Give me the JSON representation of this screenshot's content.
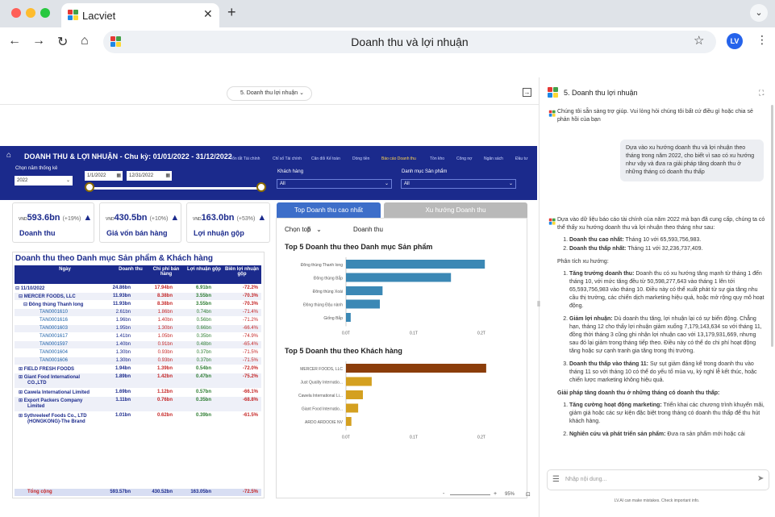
{
  "browser": {
    "tab_title": "Lacviet",
    "url_title": "Doanh thu và lợi nhuận",
    "avatar": "LV",
    "icons": [
      "back-icon",
      "forward-icon",
      "reload-icon",
      "home-icon",
      "star-icon",
      "menu-icon"
    ]
  },
  "report": {
    "page_selector": "5. Doanh thu lợi nhuận",
    "title": "DOANH THU & LỢI NHUẬN - Chu kỳ: 01/01/2022 - 31/12/2022",
    "nav_tabs": [
      "Tổn tắt Tài chính",
      "Chỉ số Tài chính",
      "Cân đối Kế toán",
      "Dòng tiền",
      "Báo cáo Doanh thu",
      "Tồn kho",
      "Công nợ",
      "Ngân sách",
      "Đầu tư"
    ],
    "filters": {
      "year_label": "Chọn năm thống kê",
      "year_value": "2022",
      "date_from": "1/1/2022",
      "date_to": "12/31/2022",
      "customer_label": "Khách hàng",
      "customer_value": "All",
      "category_label": "Danh mục Sản phẩm",
      "category_value": "All"
    },
    "kpis": [
      {
        "prefix": "VND",
        "value": "593.6bn",
        "change": "(+19%)",
        "label": "Doanh thu"
      },
      {
        "prefix": "VND",
        "value": "430.5bn",
        "change": "(+10%)",
        "label": "Giá vốn bán hàng"
      },
      {
        "prefix": "VND",
        "value": "163.0bn",
        "change": "(+53%)",
        "label": "Lợi nhuận gộp"
      }
    ],
    "table": {
      "title": "Doanh thu theo Danh mục Sản phẩm & Khách hàng",
      "headers": [
        "Ngày",
        "Doanh thu",
        "Chi phí bán hàng",
        "Lợi nhuận gộp",
        "Biên lợi nhuận gộp"
      ],
      "rows": [
        {
          "name": "⊟  11/10/2022",
          "v1": "24.86bn",
          "v2": "17.94bn",
          "v3": "6.91bn",
          "v4": "-72.2%",
          "level": 0,
          "bold": true
        },
        {
          "name": "⊟  MERCER FOODS, LLC",
          "v1": "11.93bn",
          "v2": "8.38bn",
          "v3": "3.55bn",
          "v4": "-70.3%",
          "level": 1,
          "bold": true
        },
        {
          "name": "⊟  Đông thùng Thanh long",
          "v1": "11.93bn",
          "v2": "8.38bn",
          "v3": "3.55bn",
          "v4": "-70.3%",
          "level": 2,
          "bold": true
        },
        {
          "name": "TAN0001610",
          "v1": "2.61bn",
          "v2": "1.86bn",
          "v3": "0.74bn",
          "v4": "-71.4%",
          "level": 3
        },
        {
          "name": "TAN0001616",
          "v1": "1.96bn",
          "v2": "1.40bn",
          "v3": "0.56bn",
          "v4": "-71.2%",
          "level": 3
        },
        {
          "name": "TAN0001603",
          "v1": "1.95bn",
          "v2": "1.30bn",
          "v3": "0.66bn",
          "v4": "-66.4%",
          "level": 3
        },
        {
          "name": "TAN0001617",
          "v1": "1.41bn",
          "v2": "1.05bn",
          "v3": "0.35bn",
          "v4": "-74.9%",
          "level": 3
        },
        {
          "name": "TAN0001597",
          "v1": "1.40bn",
          "v2": "0.91bn",
          "v3": "0.48bn",
          "v4": "-65.4%",
          "level": 3
        },
        {
          "name": "TAN0001604",
          "v1": "1.30bn",
          "v2": "0.93bn",
          "v3": "0.37bn",
          "v4": "-71.5%",
          "level": 3
        },
        {
          "name": "TAN0001606",
          "v1": "1.30bn",
          "v2": "0.93bn",
          "v3": "0.37bn",
          "v4": "-71.5%",
          "level": 3
        },
        {
          "name": "⊞  FIELD FRESH FOODS",
          "v1": "1.94bn",
          "v2": "1.39bn",
          "v3": "0.54bn",
          "v4": "-72.0%",
          "level": 1,
          "bold": true
        },
        {
          "name": "⊞  Giant Food International",
          "v1": "1.89bn",
          "v2": "1.42bn",
          "v3": "0.47bn",
          "v4": "-75.2%",
          "level": 1,
          "bold": true,
          "wrap": "CO.,LTD"
        },
        {
          "name": "⊞  Cawela International Limited",
          "v1": "1.69bn",
          "v2": "1.12bn",
          "v3": "0.57bn",
          "v4": "-66.1%",
          "level": 1,
          "bold": true
        },
        {
          "name": "⊞  Export Packers Company",
          "v1": "1.11bn",
          "v2": "0.76bn",
          "v3": "0.35bn",
          "v4": "-68.8%",
          "level": 1,
          "bold": true,
          "wrap": "Limited"
        },
        {
          "name": "⊞  Sythreeleef Foods Co., LTD",
          "v1": "1.01bn",
          "v2": "0.62bn",
          "v3": "0.39bn",
          "v4": "-61.5%",
          "level": 1,
          "bold": true,
          "wrap": "(HONGKONG)-The Brand"
        }
      ],
      "total": {
        "name": "Tổng cộng",
        "v1": "593.57bn",
        "v2": "430.52bn",
        "v3": "163.05bn",
        "v4": "-72.5%"
      }
    },
    "chart_tabs": [
      "Top Doanh thu cao nhất",
      "Xu hướng Doanh thu"
    ],
    "top_label": "Chọn top",
    "top_value": "5",
    "top_metric": "Doanh thu",
    "zoom": "95%"
  },
  "chart_data": [
    {
      "type": "bar",
      "orientation": "horizontal",
      "title": "Top 5 Doanh thu theo Danh mục Sản phẩm",
      "categories": [
        "Đông thùng Thanh long",
        "Đông thùng Bắp",
        "Đông thùng Xoài",
        "Đông thùng Đậu nành",
        "Giống Bắp"
      ],
      "values": [
        0.205,
        0.155,
        0.054,
        0.05,
        0.007
      ],
      "xticks": [
        "0.0T",
        "0.1T",
        "0.2T"
      ],
      "xlim": [
        0,
        0.2
      ],
      "color": "#3b88b5"
    },
    {
      "type": "bar",
      "orientation": "horizontal",
      "title": "Top 5 Doanh thu theo Khách hàng",
      "categories": [
        "MERCER FOODS, LLC",
        "Just Quality Internatio...",
        "Cawela International Li...",
        "Giant Food Internatio...",
        "ARDO ARDOOIE NV"
      ],
      "values": [
        0.207,
        0.038,
        0.025,
        0.018,
        0.008
      ],
      "xticks": [
        "0.0T",
        "0.1T",
        "0.2T"
      ],
      "xlim": [
        0,
        0.2
      ],
      "colors": [
        "#8b3d0a",
        "#d4a020",
        "#d4a020",
        "#d4a020",
        "#d4a020"
      ]
    }
  ],
  "assistant": {
    "title": "5. Doanh thu lợi nhuận",
    "greeting": "Chúng tôi sẵn sàng trợ giúp. Vui lòng hỏi chúng tôi bất cứ điều gì hoặc chia sẻ phản hồi của bạn",
    "user_question": "Dựa vào xu hướng doanh thu và lợi nhuận theo tháng trong năm 2022, cho biết vì sao có xu hướng như vậy và đưa ra giải pháp tăng doanh thu ở những tháng có doanh thu thấp",
    "answer_intro": "Dựa vào dữ liệu báo cáo tài chính của năm 2022 mà bạn đã cung cấp, chúng ta có thể thấy xu hướng doanh thu và lợi nhuận theo tháng như sau:",
    "points": [
      {
        "b": "Doanh thu cao nhất:",
        "t": " Tháng 10 với 65,593,756,983."
      },
      {
        "b": "Doanh thu thấp nhất:",
        "t": " Tháng 11 với 32,236,737,409."
      }
    ],
    "analysis_title": "Phân tích xu hướng:",
    "analysis": [
      {
        "b": "Tăng trưởng doanh thu:",
        "t": " Doanh thu có xu hướng tăng mạnh từ tháng 1 đến tháng 10, với mức tăng đều từ 50,598,277,643 vào tháng 1 lên tới 65,593,756,983 vào tháng 10. Điều này có thể xuất phát từ sự gia tăng nhu cầu thị trường, các chiến dịch marketing hiệu quả, hoặc mở rộng quy mô hoạt động."
      },
      {
        "b": "Giảm lợi nhuận:",
        "t": " Dù doanh thu tăng, lợi nhuận lại có sự biến động. Chẳng hạn, tháng 12 cho thấy lợi nhuận giảm xuống 7,179,143,634 so với tháng 11, đồng thời tháng 3 cũng ghi nhận lợi nhuận cao với 13,179,931,669, nhưng sau đó lại giảm trong tháng tiếp theo. Điều này có thể do chi phí hoạt động tăng hoặc sự cạnh tranh gia tăng trong thị trường."
      },
      {
        "b": "Doanh thu thấp vào tháng 11:",
        "t": " Sự sụt giảm đáng kể trong doanh thu vào tháng 11 so với tháng 10 có thể do yếu tố mùa vụ, kỳ nghỉ lễ kết thúc, hoặc chiến lược marketing không hiệu quả."
      }
    ],
    "solutions_title": "Giải pháp tăng doanh thu ở những tháng có doanh thu thấp:",
    "solutions": [
      {
        "b": "Tăng cường hoạt động marketing:",
        "t": " Triển khai các chương trình khuyến mãi, giảm giá hoặc các sự kiện đặc biệt trong tháng có doanh thu thấp để thu hút khách hàng."
      },
      {
        "b": "Nghiên cứu và phát triển sản phẩm:",
        "t": " Đưa ra sản phẩm mới hoặc cải"
      }
    ],
    "input_placeholder": "Nhập nội dung...",
    "disclaimer": "LV.AI can make mistakes. Check important info."
  }
}
